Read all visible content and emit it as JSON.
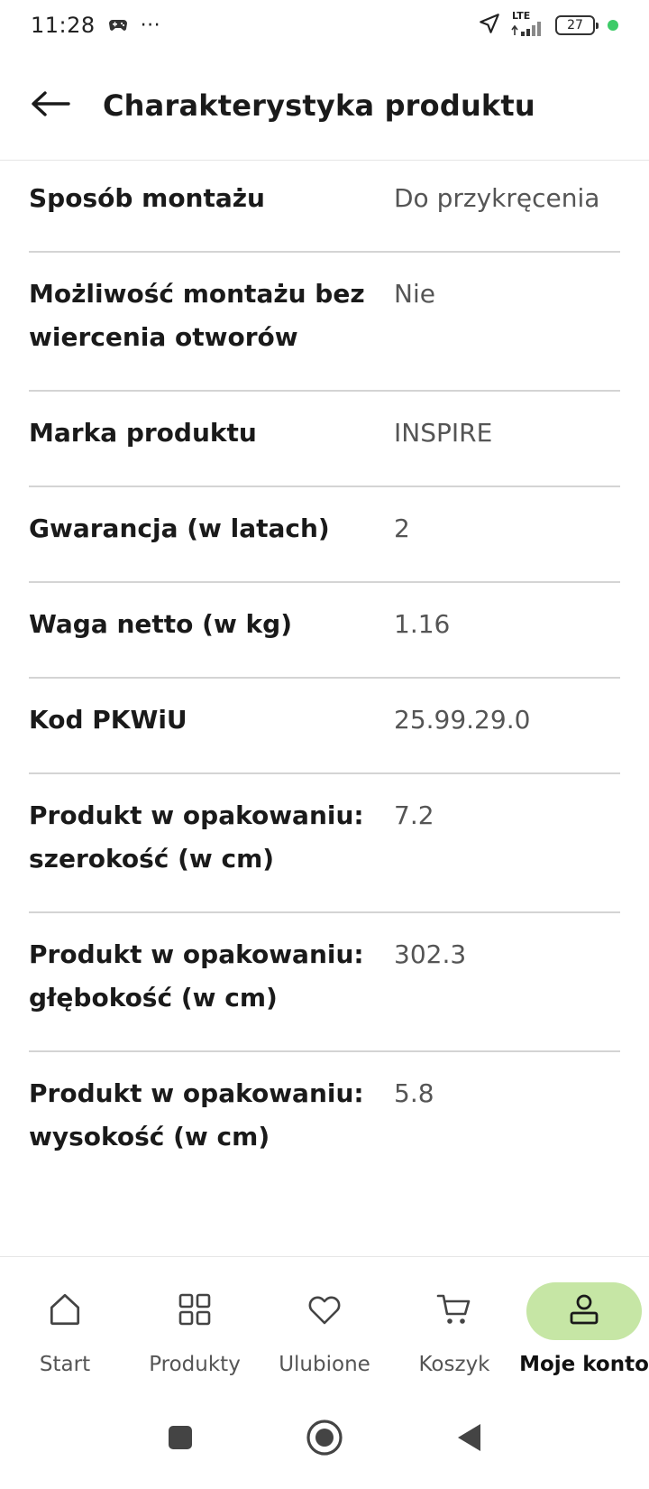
{
  "status_bar": {
    "time": "11:28",
    "more": "···",
    "network": "LTE",
    "battery": "27"
  },
  "header": {
    "title": "Charakterystyka produktu"
  },
  "attributes": [
    {
      "label": "Sposób montażu",
      "value": "Do przykręcenia"
    },
    {
      "label": "Możliwość montażu bez wiercenia otworów",
      "value": "Nie"
    },
    {
      "label": "Marka produktu",
      "value": "INSPIRE"
    },
    {
      "label": "Gwarancja (w latach)",
      "value": "2"
    },
    {
      "label": "Waga netto (w kg)",
      "value": "1.16"
    },
    {
      "label": "Kod PKWiU",
      "value": "25.99.29.0"
    },
    {
      "label": "Produkt w opakowaniu: szerokość (w cm)",
      "value": "7.2"
    },
    {
      "label": "Produkt w opakowaniu: głębokość (w cm)",
      "value": "302.3"
    },
    {
      "label": "Produkt w opakowaniu: wysokość (w cm)",
      "value": "5.8"
    }
  ],
  "bottom_nav": {
    "items": [
      {
        "label": "Start",
        "icon": "home-icon"
      },
      {
        "label": "Produkty",
        "icon": "grid-icon"
      },
      {
        "label": "Ulubione",
        "icon": "heart-icon"
      },
      {
        "label": "Koszyk",
        "icon": "cart-icon"
      },
      {
        "label": "Moje konto",
        "icon": "user-icon"
      }
    ],
    "active_index": 4,
    "active_color": "#c6e6a5"
  },
  "colors": {
    "divider": "#d4d4d4",
    "value_text": "#555555",
    "status_dot": "#3ecb68"
  }
}
